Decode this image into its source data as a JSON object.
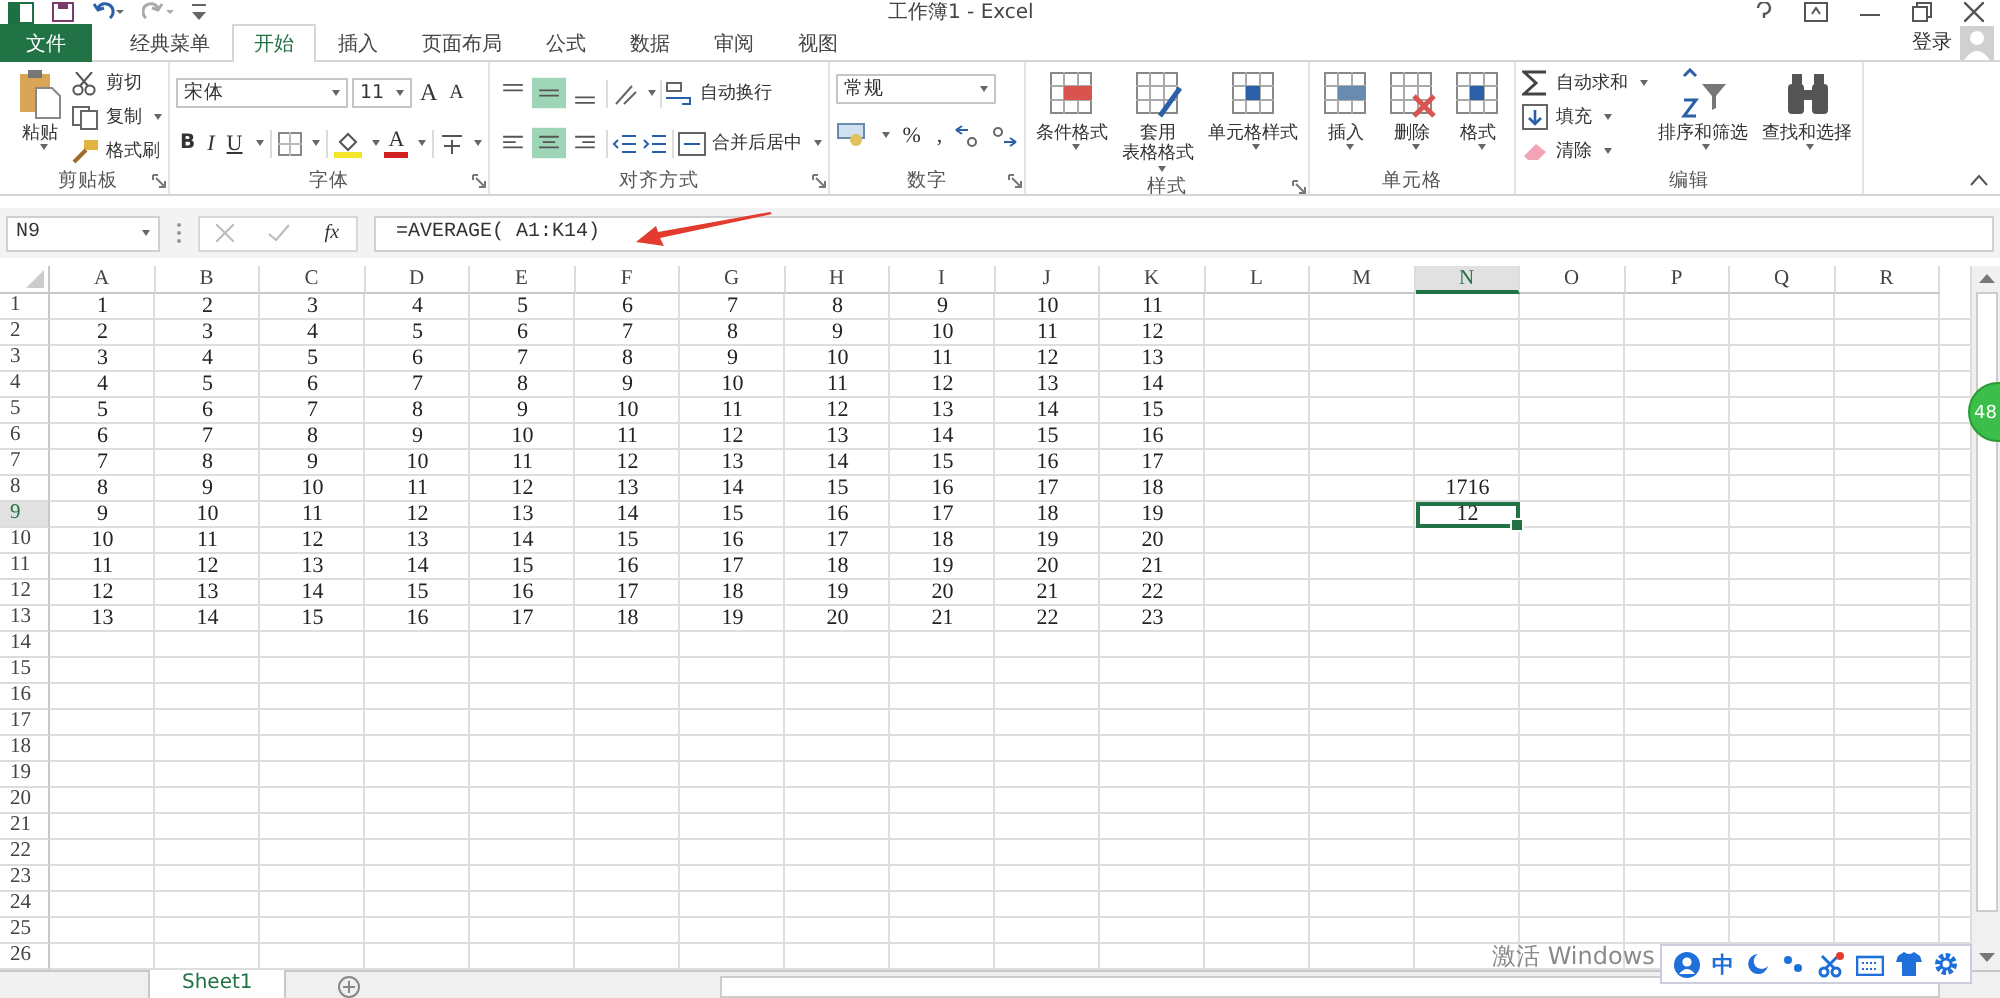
{
  "window": {
    "title": "工作簿1 - Excel",
    "sign_in": "登录"
  },
  "tabs": [
    {
      "label": "文件",
      "kind": "file",
      "selected": false
    },
    {
      "label": "经典菜单",
      "kind": "tab",
      "selected": false
    },
    {
      "label": "开始",
      "kind": "tab",
      "selected": true
    },
    {
      "label": "插入",
      "kind": "tab",
      "selected": false
    },
    {
      "label": "页面布局",
      "kind": "tab",
      "selected": false
    },
    {
      "label": "公式",
      "kind": "tab",
      "selected": false
    },
    {
      "label": "数据",
      "kind": "tab",
      "selected": false
    },
    {
      "label": "审阅",
      "kind": "tab",
      "selected": false
    },
    {
      "label": "视图",
      "kind": "tab",
      "selected": false
    }
  ],
  "ribbon": [
    {
      "kind": "clipboard",
      "label": "剪贴板",
      "launcher": true,
      "paste": "粘贴",
      "paste_dropdown": true,
      "items": [
        {
          "label": "剪切",
          "dropdown": false
        },
        {
          "label": "复制",
          "dropdown": true
        },
        {
          "label": "格式刷",
          "dropdown": false
        }
      ]
    },
    {
      "kind": "font",
      "label": "字体",
      "launcher": true,
      "font": "宋体",
      "size": "11",
      "grow": "A",
      "shrink": "A",
      "bold": "B",
      "italic": "I",
      "underline": "U",
      "font_color": "A"
    },
    {
      "kind": "alignment",
      "label": "对齐方式",
      "launcher": true,
      "vertical": [
        {
          "selected": false
        },
        {
          "selected": true
        },
        {
          "selected": false
        }
      ],
      "horizontal": [
        {
          "selected": false
        },
        {
          "selected": true
        },
        {
          "selected": false
        }
      ],
      "wrap": "自动换行",
      "merge": "合并后居中"
    },
    {
      "kind": "number",
      "label": "数字",
      "launcher": true,
      "format": "常规",
      "percent": "%",
      "comma": ","
    },
    {
      "kind": "buttons",
      "label": "样式",
      "launcher": true,
      "buttons": [
        {
          "label": "条件格式",
          "dropdown": true
        },
        {
          "label": "套用",
          "label_2": "表格格式",
          "dropdown": true
        },
        {
          "label": "单元格样式",
          "dropdown": true
        }
      ]
    },
    {
      "kind": "buttons",
      "label": "单元格",
      "launcher": false,
      "buttons": [
        {
          "label": "插入",
          "dropdown": true
        },
        {
          "label": "删除",
          "dropdown": true
        },
        {
          "label": "格式",
          "dropdown": true
        }
      ]
    },
    {
      "kind": "editing",
      "label": "编辑",
      "launcher": false,
      "items": [
        {
          "label": "自动求和",
          "dropdown": true
        },
        {
          "label": "填充",
          "dropdown": true
        },
        {
          "label": "清除",
          "dropdown": true
        }
      ],
      "buttons": [
        {
          "label": "排序和筛选",
          "dropdown": true
        },
        {
          "label": "查找和选择",
          "dropdown": true
        }
      ]
    }
  ],
  "formula_bar": {
    "name_box": "N9",
    "function_label": "fx",
    "formula": "=AVERAGE( A1:K14)"
  },
  "columns": [
    {
      "label": "A",
      "selected": false
    },
    {
      "label": "B",
      "selected": false
    },
    {
      "label": "C",
      "selected": false
    },
    {
      "label": "D",
      "selected": false
    },
    {
      "label": "E",
      "selected": false
    },
    {
      "label": "F",
      "selected": false
    },
    {
      "label": "G",
      "selected": false
    },
    {
      "label": "H",
      "selected": false
    },
    {
      "label": "I",
      "selected": false
    },
    {
      "label": "J",
      "selected": false
    },
    {
      "label": "K",
      "selected": false
    },
    {
      "label": "L",
      "selected": false
    },
    {
      "label": "M",
      "selected": false
    },
    {
      "label": "N",
      "selected": true
    },
    {
      "label": "O",
      "selected": false
    },
    {
      "label": "P",
      "selected": false
    },
    {
      "label": "Q",
      "selected": false
    },
    {
      "label": "R",
      "selected": false
    }
  ],
  "rows": [
    {
      "header": "1",
      "selected": false,
      "cells": [
        "1",
        "2",
        "3",
        "4",
        "5",
        "6",
        "7",
        "8",
        "9",
        "10",
        "11"
      ]
    },
    {
      "header": "2",
      "selected": false,
      "cells": [
        "2",
        "3",
        "4",
        "5",
        "6",
        "7",
        "8",
        "9",
        "10",
        "11",
        "12"
      ]
    },
    {
      "header": "3",
      "selected": false,
      "cells": [
        "3",
        "4",
        "5",
        "6",
        "7",
        "8",
        "9",
        "10",
        "11",
        "12",
        "13"
      ]
    },
    {
      "header": "4",
      "selected": false,
      "cells": [
        "4",
        "5",
        "6",
        "7",
        "8",
        "9",
        "10",
        "11",
        "12",
        "13",
        "14"
      ]
    },
    {
      "header": "5",
      "selected": false,
      "cells": [
        "5",
        "6",
        "7",
        "8",
        "9",
        "10",
        "11",
        "12",
        "13",
        "14",
        "15"
      ]
    },
    {
      "header": "6",
      "selected": false,
      "cells": [
        "6",
        "7",
        "8",
        "9",
        "10",
        "11",
        "12",
        "13",
        "14",
        "15",
        "16"
      ]
    },
    {
      "header": "7",
      "selected": false,
      "cells": [
        "7",
        "8",
        "9",
        "10",
        "11",
        "12",
        "13",
        "14",
        "15",
        "16",
        "17"
      ]
    },
    {
      "header": "8",
      "selected": false,
      "cells": [
        "8",
        "9",
        "10",
        "11",
        "12",
        "13",
        "14",
        "15",
        "16",
        "17",
        "18",
        null,
        null,
        "1716"
      ]
    },
    {
      "header": "9",
      "selected": true,
      "cells": [
        "9",
        "10",
        "11",
        "12",
        "13",
        "14",
        "15",
        "16",
        "17",
        "18",
        "19",
        null,
        null,
        {
          "value": "12",
          "selected": true
        }
      ]
    },
    {
      "header": "10",
      "selected": false,
      "cells": [
        "10",
        "11",
        "12",
        "13",
        "14",
        "15",
        "16",
        "17",
        "18",
        "19",
        "20"
      ]
    },
    {
      "header": "11",
      "selected": false,
      "cells": [
        "11",
        "12",
        "13",
        "14",
        "15",
        "16",
        "17",
        "18",
        "19",
        "20",
        "21"
      ]
    },
    {
      "header": "12",
      "selected": false,
      "cells": [
        "12",
        "13",
        "14",
        "15",
        "16",
        "17",
        "18",
        "19",
        "20",
        "21",
        "22"
      ]
    },
    {
      "header": "13",
      "selected": false,
      "cells": [
        "13",
        "14",
        "15",
        "16",
        "17",
        "18",
        "19",
        "20",
        "21",
        "22",
        "23"
      ]
    },
    {
      "header": "14",
      "selected": false,
      "cells": []
    },
    {
      "header": "15",
      "selected": false,
      "cells": []
    },
    {
      "header": "16",
      "selected": false,
      "cells": []
    },
    {
      "header": "17",
      "selected": false,
      "cells": []
    },
    {
      "header": "18",
      "selected": false,
      "cells": []
    },
    {
      "header": "19",
      "selected": false,
      "cells": []
    },
    {
      "header": "20",
      "selected": false,
      "cells": []
    },
    {
      "header": "21",
      "selected": false,
      "cells": []
    },
    {
      "header": "22",
      "selected": false,
      "cells": []
    },
    {
      "header": "23",
      "selected": false,
      "cells": []
    },
    {
      "header": "24",
      "selected": false,
      "cells": []
    },
    {
      "header": "25",
      "selected": false,
      "cells": []
    },
    {
      "header": "26",
      "selected": false,
      "cells": []
    }
  ],
  "sheets": [
    {
      "label": "Sheet1",
      "selected": true
    }
  ],
  "badge": {
    "text": "48"
  },
  "ime_toolbar": {
    "language": "中"
  },
  "activation_notice": {
    "text": "激活 Windows"
  }
}
